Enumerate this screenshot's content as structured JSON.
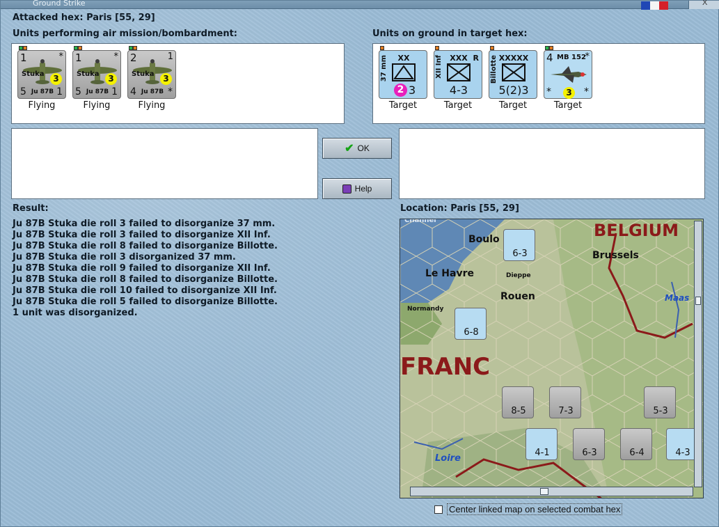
{
  "window": {
    "title": "Ground Strike",
    "close_label": "X"
  },
  "attacked_hex": "Attacked hex: Paris  [55, 29]",
  "air_units": {
    "label": "Units performing air mission/bombardment:",
    "units": [
      {
        "top_left": "1",
        "top_right": "*",
        "bottom_left": "5",
        "bottom_right": "1",
        "name": "Ju 87B",
        "type": "Stuka",
        "value": "3",
        "caption": "Flying"
      },
      {
        "top_left": "1",
        "top_right": "*",
        "bottom_left": "5",
        "bottom_right": "1",
        "name": "Ju 87B",
        "type": "Stuka",
        "value": "3",
        "caption": "Flying"
      },
      {
        "top_left": "2",
        "top_right": "1",
        "bottom_left": "4",
        "bottom_right": "*",
        "name": "Ju 87B",
        "type": "Stuka",
        "value": "3",
        "caption": "Flying"
      }
    ]
  },
  "ground_units": {
    "label": "Units on ground in target hex:",
    "units": [
      {
        "echelon": "XX",
        "side": "37 mm",
        "disorg": "2",
        "strength": "3",
        "caption": "Target"
      },
      {
        "echelon": "XXX",
        "side": "XII Inf",
        "corner": "R",
        "strength": "4-3",
        "caption": "Target"
      },
      {
        "echelon": "XXXXX",
        "side": "Billotte",
        "strength": "5(2)3",
        "caption": "Target"
      },
      {
        "top_left": "4",
        "name": "MB 152",
        "top_right": "*",
        "bottom_left": "*",
        "bottom_right": "*",
        "value": "3",
        "caption": "Target"
      }
    ]
  },
  "buttons": {
    "ok": "OK",
    "help": "Help"
  },
  "result": {
    "label": "Result:",
    "lines": [
      "Ju 87B Stuka die roll 3 failed to disorganize 37 mm.",
      "Ju 87B Stuka die roll 3 failed to disorganize XII Inf.",
      "Ju 87B Stuka die roll 8 failed to disorganize Billotte.",
      "Ju 87B Stuka die roll 3 disorganized 37 mm.",
      "Ju 87B Stuka die roll 9 failed to disorganize XII Inf.",
      "Ju 87B Stuka die roll 8 failed to disorganize Billotte.",
      "Ju 87B Stuka die roll 10 failed to disorganize XII Inf.",
      "Ju 87B Stuka die roll 5 failed to disorganize Billotte.",
      "1 unit was disorganized."
    ]
  },
  "location": {
    "label": "Location:  Paris  [55, 29]",
    "map_labels": {
      "belgium": "BELGIUM",
      "brussels": "Brussels",
      "boulogne": "Boulo",
      "le_havre": "Le Havre",
      "dieppe": "Dieppe",
      "rouen": "Rouen",
      "normandy": "Normandy",
      "maas": "Maas",
      "loire": "Loire",
      "france": "FRANC",
      "channel": "Channel"
    },
    "map_counters": [
      {
        "strength": "6-3"
      },
      {
        "strength": "6-8"
      },
      {
        "strength": "8-5"
      },
      {
        "strength": "7-3"
      },
      {
        "strength": "5-3"
      },
      {
        "strength": "4-1"
      },
      {
        "strength": "6-3"
      },
      {
        "strength": "6-4"
      },
      {
        "strength": "4-3"
      }
    ]
  },
  "center_checkbox": "Center linked map on selected combat hex"
}
